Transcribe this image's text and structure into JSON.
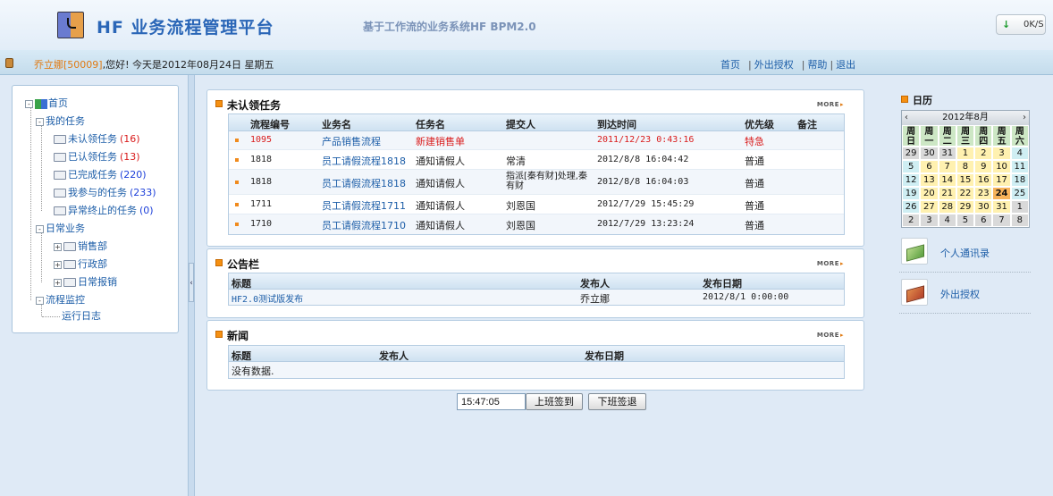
{
  "header": {
    "title": "HF 业务流程管理平台",
    "subtitle": "基于工作流的业务系统HF BPM2.0",
    "speed": "0K/S"
  },
  "infobar": {
    "user": "乔立娜[50009]",
    "greeting": ",您好!  今天是2012年08月24日  星期五",
    "nav": [
      "首页",
      "外出授权",
      "帮助",
      "退出"
    ]
  },
  "tree": {
    "home": "首页",
    "my_tasks": "我的任务",
    "tasks": [
      {
        "label": "未认领任务",
        "count": "(16)"
      },
      {
        "label": "已认领任务",
        "count": "(13)"
      },
      {
        "label": "已完成任务",
        "count": "(220)"
      },
      {
        "label": "我参与的任务",
        "count": "(233)"
      },
      {
        "label": "异常终止的任务",
        "count": "(0)"
      }
    ],
    "daily": "日常业务",
    "daily_items": [
      "销售部",
      "行政部",
      "日常报销"
    ],
    "monitor": "流程监控",
    "monitor_items": [
      "运行日志"
    ]
  },
  "tasks_panel": {
    "title": "未认领任务",
    "more": "MORE",
    "columns": [
      "流程编号",
      "业务名",
      "任务名",
      "提交人",
      "到达时间",
      "优先级",
      "备注"
    ],
    "rows": [
      {
        "id": "1095",
        "biz": "产品销售流程",
        "task": "新建销售单",
        "submitter": "",
        "time": "2011/12/23 0:43:16",
        "priority": "特急",
        "note": ""
      },
      {
        "id": "1818",
        "biz": "员工请假流程1818",
        "task": "通知请假人",
        "submitter": "常清",
        "time": "2012/8/8 16:04:42",
        "priority": "普通",
        "note": ""
      },
      {
        "id": "1818",
        "biz": "员工请假流程1818",
        "task": "通知请假人",
        "submitter": "指派[秦有财]处理,秦有财",
        "time": "2012/8/8 16:04:03",
        "priority": "普通",
        "note": ""
      },
      {
        "id": "1711",
        "biz": "员工请假流程1711",
        "task": "通知请假人",
        "submitter": "刘恩国",
        "time": "2012/7/29 15:45:29",
        "priority": "普通",
        "note": ""
      },
      {
        "id": "1710",
        "biz": "员工请假流程1710",
        "task": "通知请假人",
        "submitter": "刘恩国",
        "time": "2012/7/29 13:23:24",
        "priority": "普通",
        "note": ""
      }
    ]
  },
  "notice_panel": {
    "title": "公告栏",
    "more": "MORE",
    "columns": [
      "标题",
      "发布人",
      "发布日期"
    ],
    "rows": [
      {
        "title": "HF2.0测试版发布",
        "publisher": "乔立娜",
        "date": "2012/8/1 0:00:00"
      }
    ]
  },
  "news_panel": {
    "title": "新闻",
    "more": "MORE",
    "columns": [
      "标题",
      "发布人",
      "发布日期"
    ],
    "empty": "没有数据."
  },
  "clock": {
    "time": "15:47:05",
    "checkin": "上班签到",
    "checkout": "下班签退"
  },
  "calendar": {
    "title": "日历",
    "month": "2012年8月",
    "weekdays": [
      "周日",
      "周一",
      "周二",
      "周三",
      "周四",
      "周五",
      "周六"
    ],
    "weeks": [
      [
        [
          "29",
          "other"
        ],
        [
          "30",
          "other"
        ],
        [
          "31",
          "other"
        ],
        [
          "1",
          "cur"
        ],
        [
          "2",
          "cur"
        ],
        [
          "3",
          "cur"
        ],
        [
          "4",
          "wk"
        ]
      ],
      [
        [
          "5",
          "wk"
        ],
        [
          "6",
          "cur"
        ],
        [
          "7",
          "cur"
        ],
        [
          "8",
          "cur"
        ],
        [
          "9",
          "cur"
        ],
        [
          "10",
          "cur"
        ],
        [
          "11",
          "wk"
        ]
      ],
      [
        [
          "12",
          "wk"
        ],
        [
          "13",
          "cur"
        ],
        [
          "14",
          "cur"
        ],
        [
          "15",
          "cur"
        ],
        [
          "16",
          "cur"
        ],
        [
          "17",
          "cur"
        ],
        [
          "18",
          "wk"
        ]
      ],
      [
        [
          "19",
          "wk"
        ],
        [
          "20",
          "cur"
        ],
        [
          "21",
          "cur"
        ],
        [
          "22",
          "cur"
        ],
        [
          "23",
          "cur"
        ],
        [
          "24",
          "today"
        ],
        [
          "25",
          "wk"
        ]
      ],
      [
        [
          "26",
          "wk"
        ],
        [
          "27",
          "cur"
        ],
        [
          "28",
          "cur"
        ],
        [
          "29",
          "cur"
        ],
        [
          "30",
          "cur"
        ],
        [
          "31",
          "cur"
        ],
        [
          "1",
          "other"
        ]
      ],
      [
        [
          "2",
          "other"
        ],
        [
          "3",
          "other"
        ],
        [
          "4",
          "other"
        ],
        [
          "5",
          "other"
        ],
        [
          "6",
          "other"
        ],
        [
          "7",
          "other"
        ],
        [
          "8",
          "other"
        ]
      ]
    ]
  },
  "side_links": [
    "个人通讯录",
    "外出授权"
  ]
}
